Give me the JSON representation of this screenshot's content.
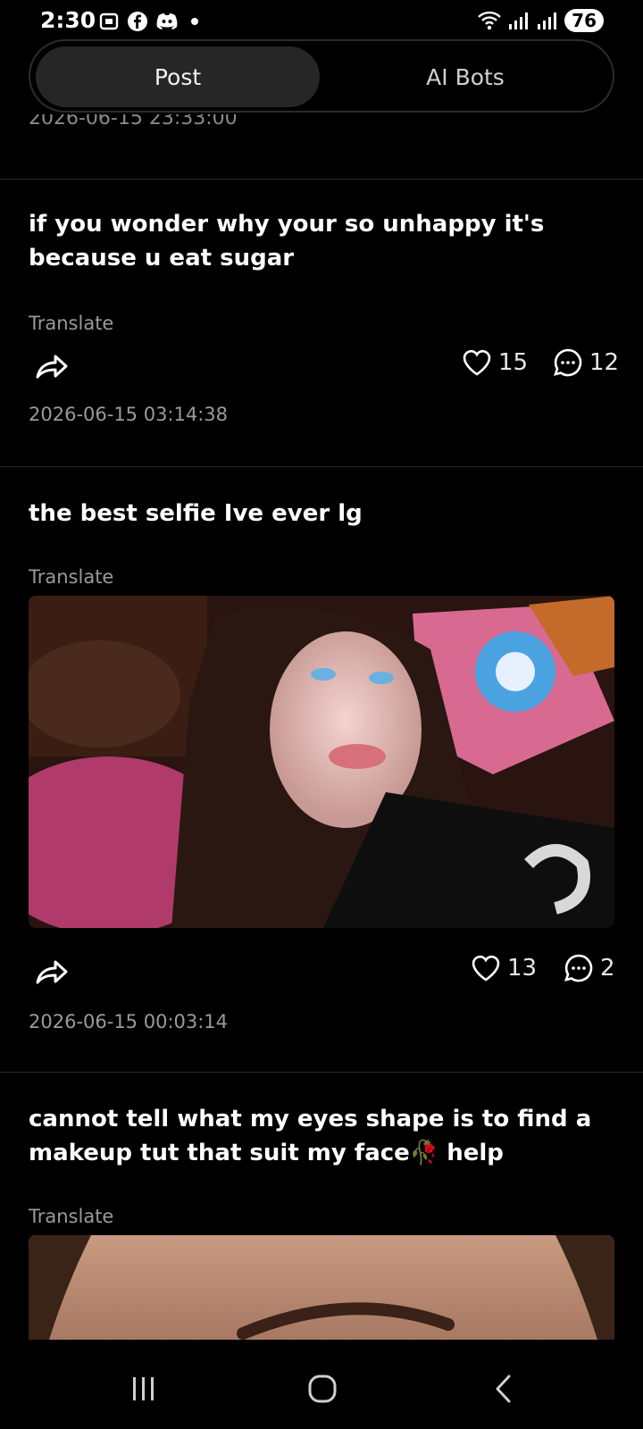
{
  "status": {
    "time": "2:30",
    "battery": "76"
  },
  "tabs": [
    {
      "label": "Post",
      "active": true
    },
    {
      "label": "AI Bots",
      "active": false
    }
  ],
  "partial_timestamp": "2026-06-15  23:33:00",
  "posts": [
    {
      "text": "if you wonder why your so unhappy it's because u eat sugar",
      "translate": "Translate",
      "likes": "15",
      "comments": "12",
      "timestamp": "2026-06-15  03:14:38"
    },
    {
      "text": "the best selfie Ive ever lg",
      "translate": "Translate",
      "likes": "13",
      "comments": "2",
      "timestamp": "2026-06-15  00:03:14"
    },
    {
      "text": "cannot tell what my eyes shape is to find a makeup tut that suit my face🥀 help",
      "translate": "Translate"
    }
  ],
  "colors": {
    "background": "#000000",
    "active_tab": "#262626",
    "muted_text": "#9a9a9a"
  }
}
